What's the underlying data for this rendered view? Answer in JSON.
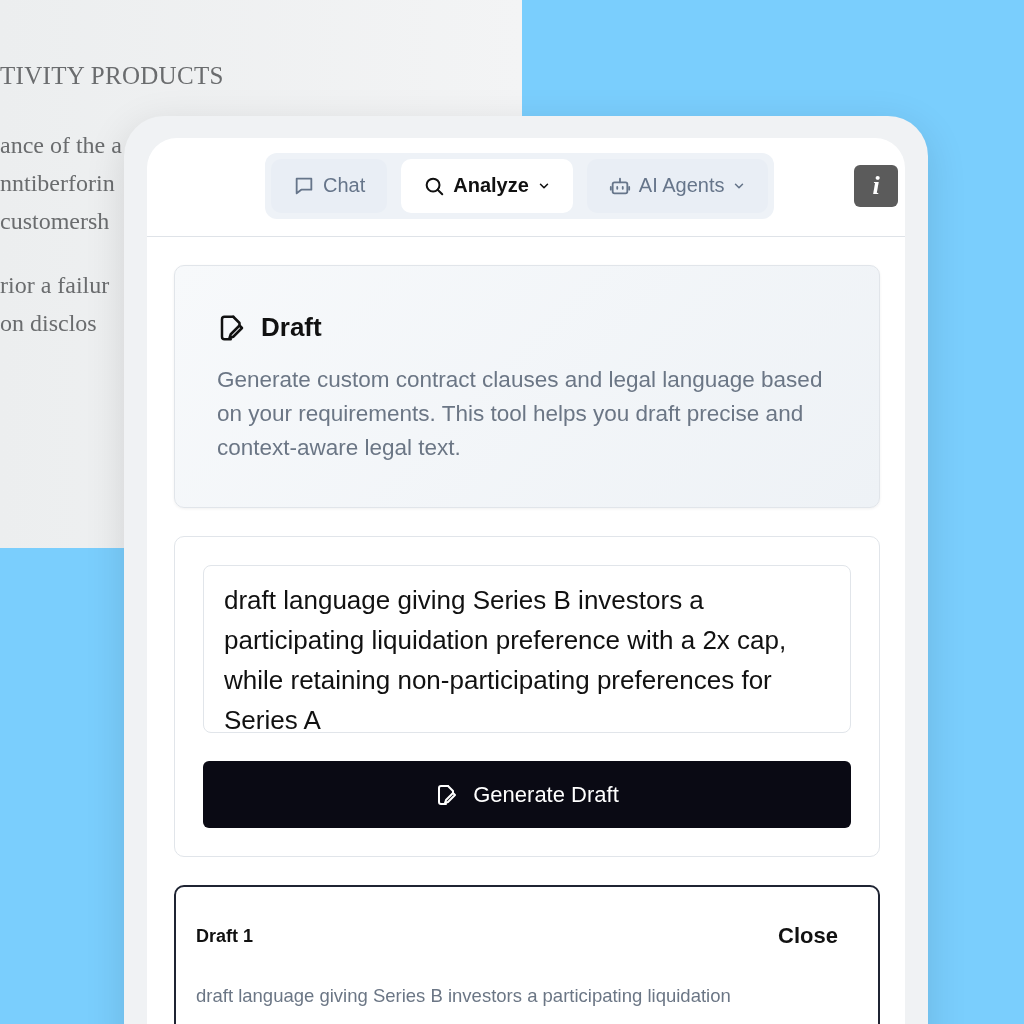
{
  "document": {
    "heading": "TIVITY PRODUCTS",
    "lines": [
      "ance of the a",
      "nntiberforin",
      "customersh",
      "rior a failur",
      "on disclos"
    ]
  },
  "tabs": [
    {
      "label": "Chat",
      "kind": "chat",
      "dropdown": false,
      "selected": false
    },
    {
      "label": "Analyze",
      "kind": "search",
      "dropdown": true,
      "selected": true
    },
    {
      "label": "AI Agents",
      "kind": "robot",
      "dropdown": true,
      "selected": false
    }
  ],
  "info_button": "i",
  "intro": {
    "title": "Draft",
    "description": "Generate custom contract clauses and legal language based on your requirements. This tool helps you draft precise and context-aware legal text."
  },
  "prompt": {
    "value": "draft language giving Series B investors a participating liquidation preference with a 2x cap, while retaining non-participating preferences for Series A"
  },
  "generate_button": "Generate Draft",
  "result": {
    "title": "Draft 1",
    "close": "Close",
    "text": "draft language giving Series B investors a participating liquidation"
  }
}
